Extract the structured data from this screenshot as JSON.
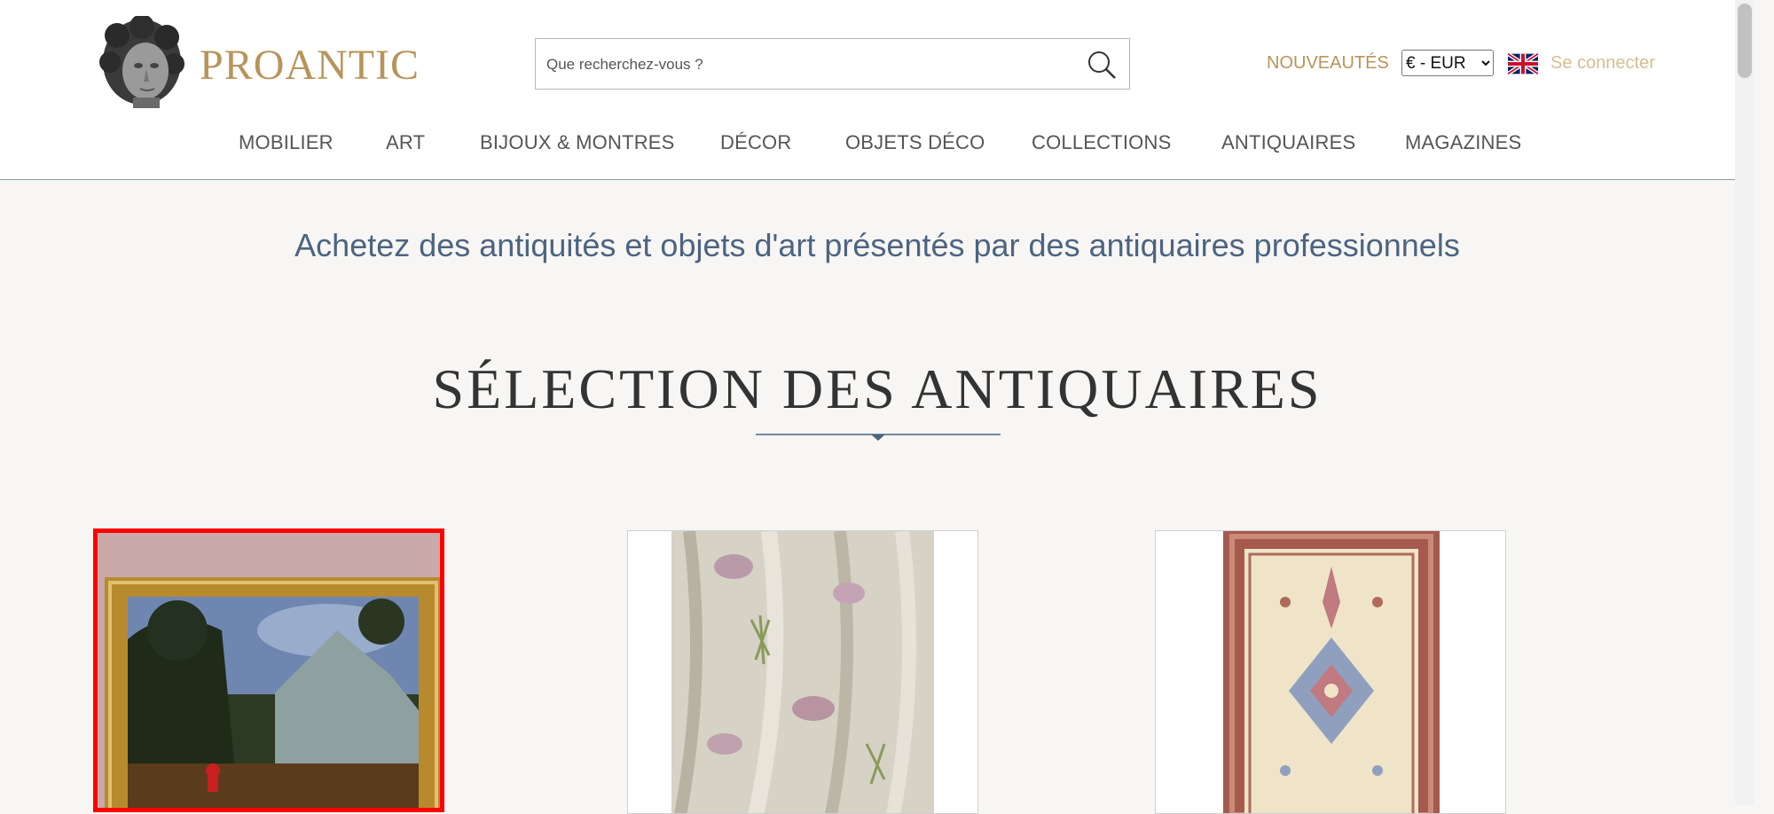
{
  "header": {
    "logo_text": "PROANTIC",
    "search_placeholder": "Que recherchez-vous ?",
    "nouveautes": "NOUVEAUTÉS",
    "currency_selected": "€ - EUR",
    "login": "Se connecter"
  },
  "nav": {
    "items": [
      "MOBILIER",
      "ART",
      "BIJOUX & MONTRES",
      "DÉCOR",
      "OBJETS DÉCO",
      "COLLECTIONS",
      "ANTIQUAIRES",
      "MAGAZINES"
    ]
  },
  "main": {
    "tagline": "Achetez des antiquités et objets d'art présentés par des antiquaires professionnels",
    "section_title": "SÉLECTION DES ANTIQUAIRES"
  },
  "colors": {
    "accent_gold": "#b8945a",
    "tagline_blue": "#4d6480",
    "selection_red": "#ff0000"
  }
}
